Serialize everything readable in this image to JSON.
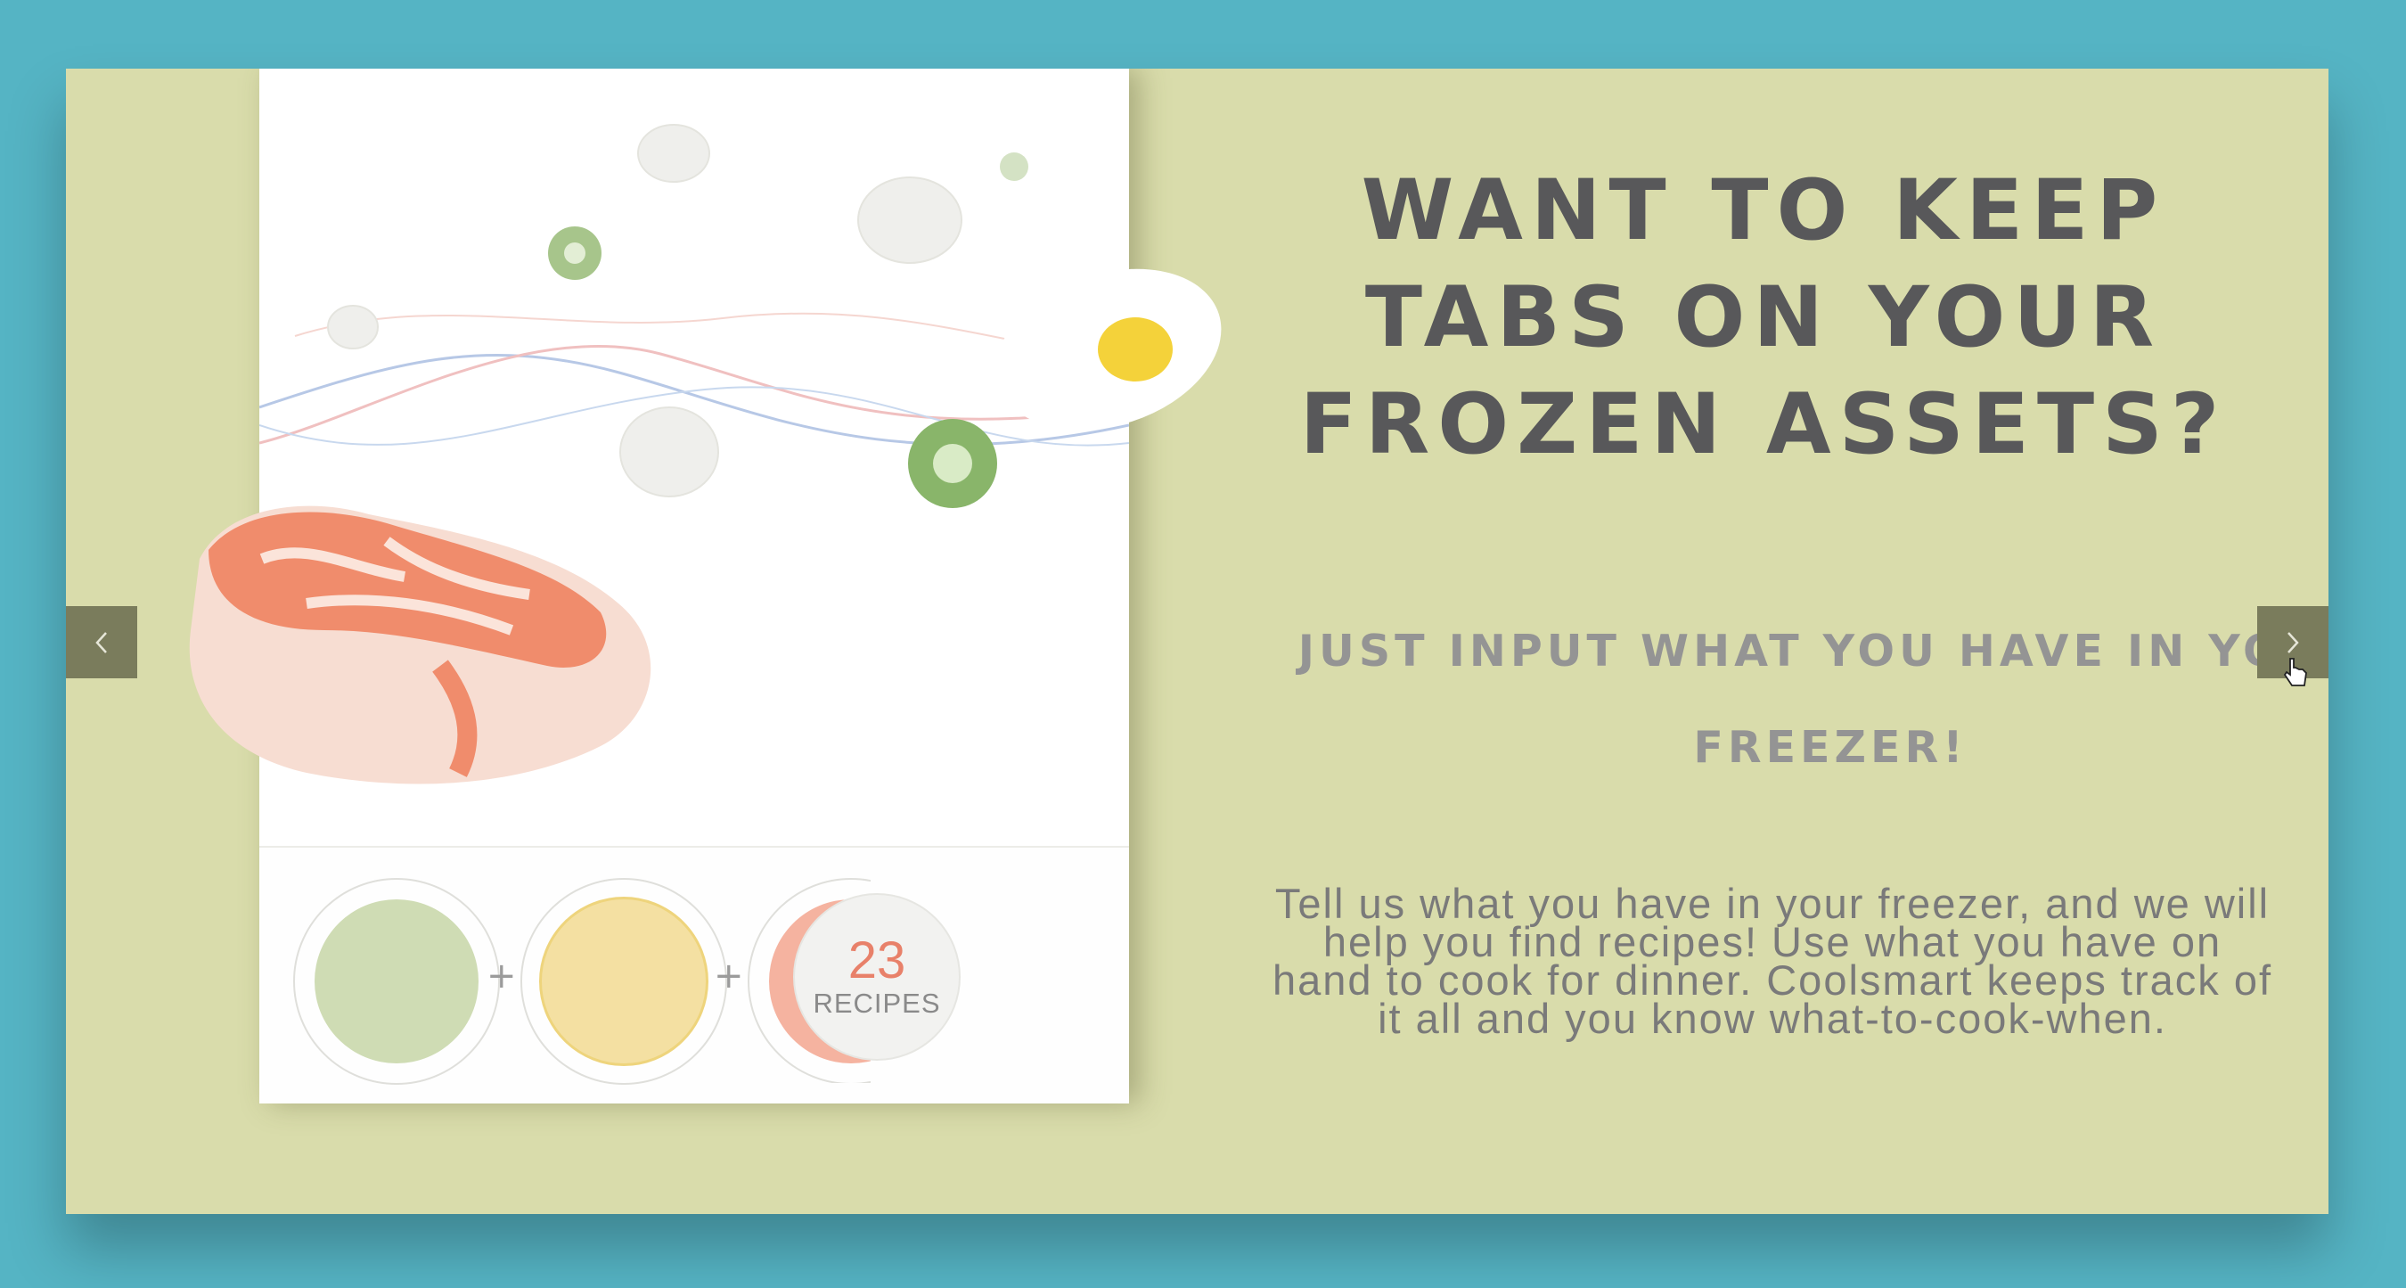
{
  "slide": {
    "heading": "WANT TO KEEP TABS ON YOUR FROZEN ASSETS?",
    "subheading": "JUST INPUT WHAT YOU HAVE IN YOUR FREEZER!",
    "body": "Tell us what you have in your freezer, and we will help you find recipes!  Use what you have on hand to cook for dinner. Coolsmart keeps track of it all and you know what-to-cook-when."
  },
  "app_preview": {
    "recipes_count": "23",
    "recipes_label": "RECIPES",
    "ingredient_circles": [
      "#cfdcb4",
      "#f4e0a2",
      "#f5b3a0"
    ],
    "plus_symbol": "+"
  },
  "navigation": {
    "prev_icon": "chevron-left-icon",
    "next_icon": "chevron-right-icon"
  },
  "colors": {
    "background": "#55b4c4",
    "slide_background": "#d9dcab",
    "heading": "#58585a",
    "nav_button": "#7a7c5c",
    "accent_recipes": "#e8816a"
  }
}
